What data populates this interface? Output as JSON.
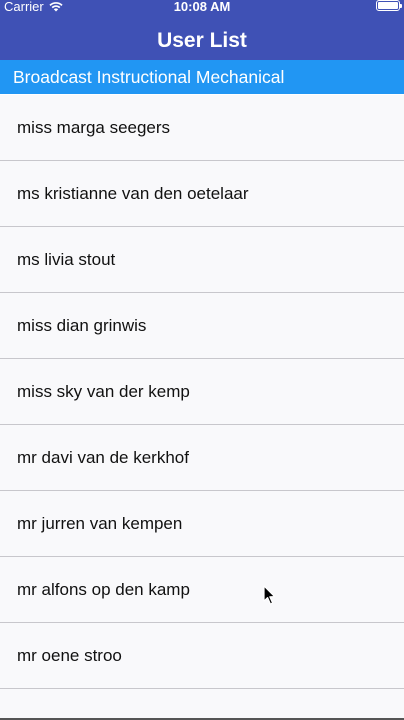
{
  "status_bar": {
    "carrier": "Carrier",
    "time": "10:08 AM",
    "battery_level": 1.0,
    "wifi_icon": "wifi-icon",
    "battery_icon": "battery-icon"
  },
  "nav": {
    "title": "User List"
  },
  "banner": {
    "text": "Broadcast Instructional Mechanical"
  },
  "users": [
    "miss marga seegers",
    "ms kristianne van den oetelaar",
    "ms livia stout",
    "miss dian grinwis",
    "miss sky van der kemp",
    "mr davi van de kerkhof",
    "mr jurren van kempen",
    "mr alfons op den kamp",
    "mr oene stroo"
  ],
  "colors": {
    "nav_background": "#3f51b5",
    "banner_background": "#2196f3",
    "list_background": "#f9f9fb"
  }
}
